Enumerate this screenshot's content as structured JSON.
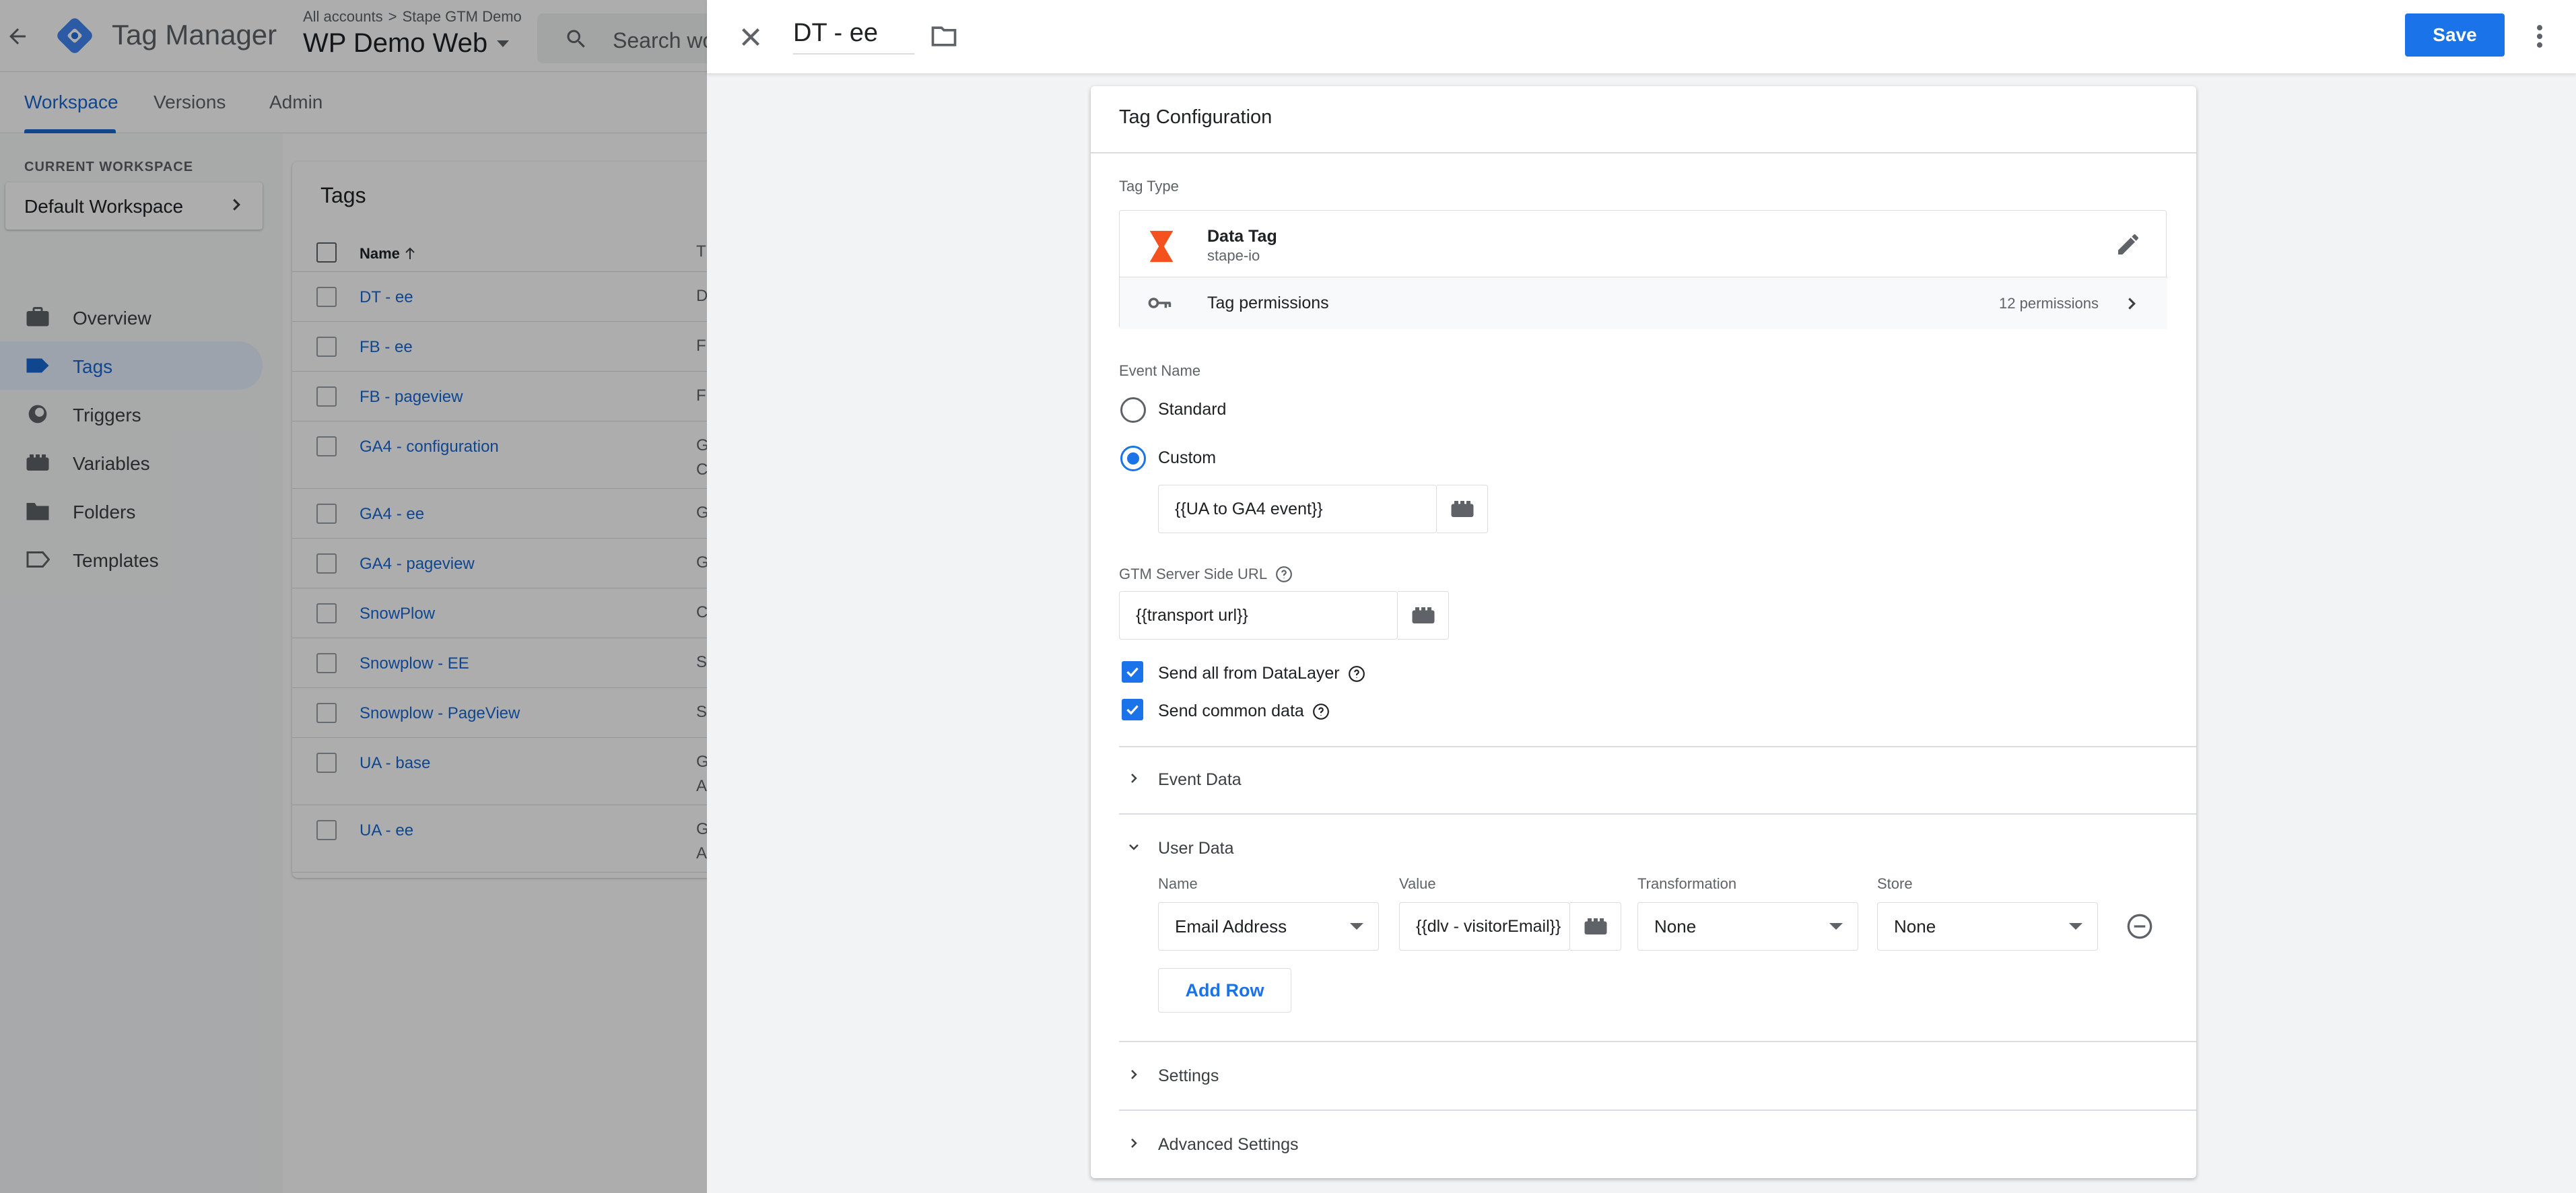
{
  "app": {
    "product_name": "Tag Manager",
    "breadcrumb": {
      "root": "All accounts",
      "account": "Stape GTM Demo"
    },
    "container_name": "WP Demo Web",
    "search_placeholder": "Search wo",
    "tabs": [
      "Workspace",
      "Versions",
      "Admin"
    ],
    "current_workspace_label": "CURRENT WORKSPACE",
    "workspace_name": "Default Workspace",
    "nav": [
      {
        "label": "Overview",
        "icon": "briefcase-icon"
      },
      {
        "label": "Tags",
        "icon": "tag-icon"
      },
      {
        "label": "Triggers",
        "icon": "trigger-icon"
      },
      {
        "label": "Variables",
        "icon": "variables-icon"
      },
      {
        "label": "Folders",
        "icon": "folder-icon"
      },
      {
        "label": "Templates",
        "icon": "template-icon"
      }
    ],
    "tags_title": "Tags",
    "tags_header": {
      "name": "Name",
      "type": "T"
    },
    "tags": [
      {
        "name": "DT - ee",
        "type": "D"
      },
      {
        "name": "FB - ee",
        "type": "F"
      },
      {
        "name": "FB - pageview",
        "type": "F"
      },
      {
        "name": "GA4 - configuration",
        "type": "G",
        "type2": "C"
      },
      {
        "name": "GA4 - ee",
        "type": "G"
      },
      {
        "name": "GA4 - pageview",
        "type": "G"
      },
      {
        "name": "SnowPlow",
        "type": "C"
      },
      {
        "name": "Snowplow - EE",
        "type": "S"
      },
      {
        "name": "Snowplow - PageView",
        "type": "S"
      },
      {
        "name": "UA - base",
        "type": "G",
        "type2": "A"
      },
      {
        "name": "UA - ee",
        "type": "G",
        "type2": "A"
      }
    ]
  },
  "panel": {
    "tag_name": "DT - ee",
    "save_label": "Save",
    "card_title": "Tag Configuration",
    "tag_type_label": "Tag Type",
    "tag_type": {
      "name": "Data Tag",
      "vendor": "stape-io"
    },
    "permissions": {
      "label": "Tag permissions",
      "count": "12 permissions"
    },
    "event_name_label": "Event Name",
    "event_name_options": {
      "standard": "Standard",
      "custom": "Custom"
    },
    "event_name_value": "{{UA to GA4 event}}",
    "server_url_label": "GTM Server Side URL",
    "server_url_value": "{{transport url}}",
    "send_all_label": "Send all from DataLayer",
    "send_common_label": "Send common data",
    "sections": {
      "event_data": "Event Data",
      "user_data": "User Data",
      "settings": "Settings",
      "advanced": "Advanced Settings"
    },
    "user_data": {
      "columns": {
        "name": "Name",
        "value": "Value",
        "transformation": "Transformation",
        "store": "Store"
      },
      "row": {
        "name": "Email Address",
        "value": "{{dlv - visitorEmail}}",
        "transformation": "None",
        "store": "None"
      },
      "add_row_label": "Add Row"
    }
  },
  "colors": {
    "accent": "#1a73e8",
    "link": "#1967d2",
    "data_tag_icon": "#f4511e"
  }
}
